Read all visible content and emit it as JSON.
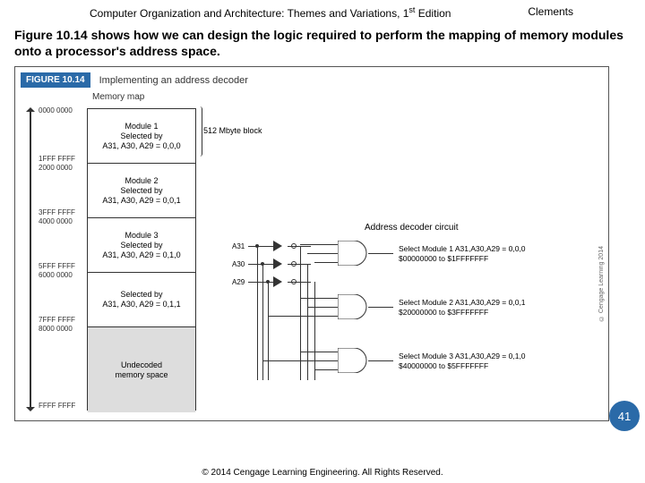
{
  "header": {
    "title_a": "Computer Organization and Architecture: Themes and Variations, 1",
    "title_sup": "st",
    "title_b": " Edition",
    "author": "Clements"
  },
  "caption": "Figure 10.14 shows how we can design the logic required to perform the mapping of memory modules onto a processor's address space.",
  "figure": {
    "badge": "FIGURE 10.14",
    "title": "Implementing an address decoder",
    "memory_map_label": "Memory map",
    "block_size": "512 Mbyte block",
    "decoder_label": "Address decoder circuit",
    "modules": [
      {
        "name": "Module 1",
        "sel_prefix": "Selected by",
        "sel_bits": "A31, A30, A29 = 0,0,0"
      },
      {
        "name": "Module 2",
        "sel_prefix": "Selected by",
        "sel_bits": "A31, A30, A29 = 0,0,1"
      },
      {
        "name": "Module 3",
        "sel_prefix": "Selected by",
        "sel_bits": "A31, A30, A29 = 0,1,0"
      },
      {
        "name": "",
        "sel_prefix": "Selected by",
        "sel_bits": "A31, A30, A29 = 0,1,1"
      }
    ],
    "undecoded": "Undecoded\nmemory space",
    "addresses": [
      "0000 0000",
      "1FFF FFFF",
      "2000 0000",
      "3FFF FFFF",
      "4000 0000",
      "5FFF FFFF",
      "6000 0000",
      "7FFF FFFF",
      "8000 0000",
      "FFFF FFFF"
    ],
    "signals": [
      "A31",
      "A30",
      "A29"
    ],
    "outputs": [
      {
        "line1": "Select Module 1  A31,A30,A29 = 0,0,0",
        "line2": "$00000000 to $1FFFFFFF"
      },
      {
        "line1": "Select Module 2  A31,A30,A29 = 0,0,1",
        "line2": "$20000000 to $3FFFFFFF"
      },
      {
        "line1": "Select Module 3  A31,A30,A29 = 0,1,0",
        "line2": "$40000000 to $5FFFFFFF"
      }
    ],
    "side_copyright": "© Cengage Learning 2014"
  },
  "footer": "© 2014 Cengage Learning Engineering. All Rights Reserved.",
  "page": "41"
}
